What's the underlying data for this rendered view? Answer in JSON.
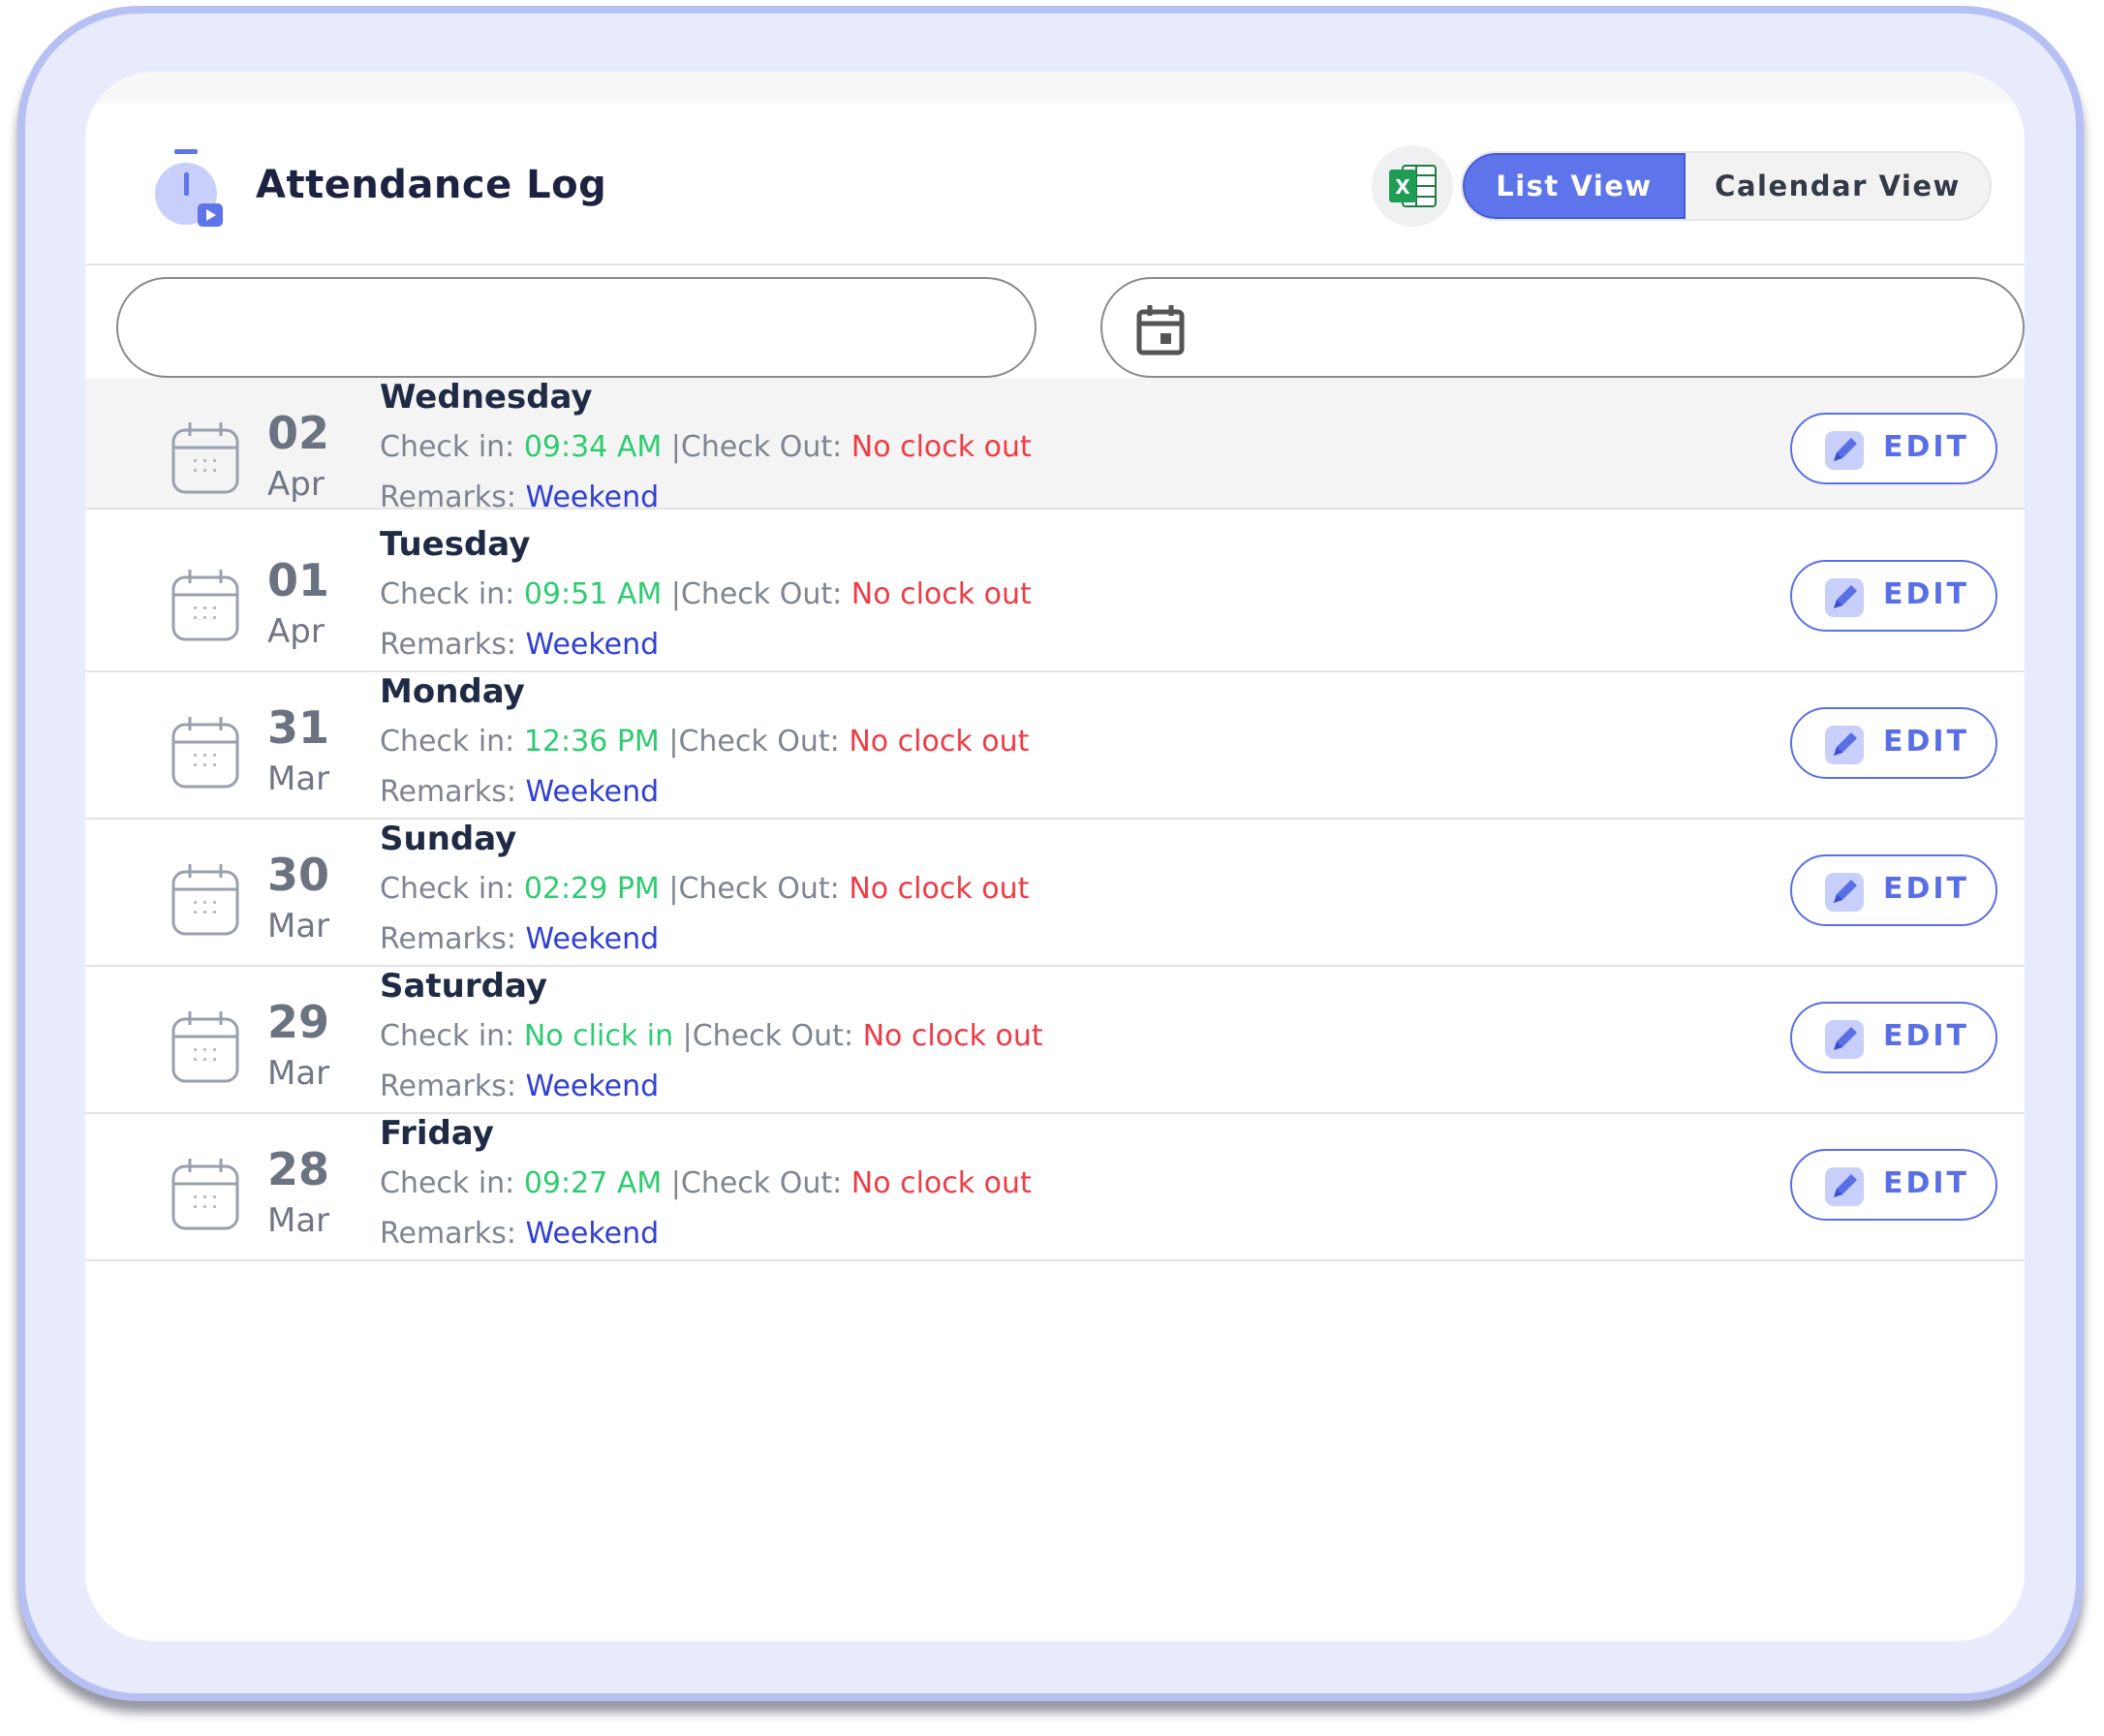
{
  "header": {
    "title": "Attendance Log",
    "excel_icon": "excel-icon",
    "views": [
      {
        "label": "List View",
        "active": true
      },
      {
        "label": "Calendar View",
        "active": false
      }
    ]
  },
  "filters": {
    "search_value": "",
    "date_value": "",
    "date_icon": "calendar-icon"
  },
  "labels": {
    "check_in": "Check in: ",
    "check_out": "Check Out: ",
    "separator": "|",
    "remarks": "Remarks: ",
    "edit": "EDIT"
  },
  "colors": {
    "accent": "#5e74ea",
    "check_in": "#2ecc71",
    "check_out": "#ef3b44",
    "remarks": "#2f3fd1"
  },
  "records": [
    {
      "day": "02",
      "month": "Apr",
      "weekday": "Wednesday",
      "check_in": "09:34 AM",
      "check_out": "No clock out",
      "remarks": "Weekend"
    },
    {
      "day": "01",
      "month": "Apr",
      "weekday": "Tuesday",
      "check_in": "09:51 AM",
      "check_out": "No clock out",
      "remarks": "Weekend"
    },
    {
      "day": "31",
      "month": "Mar",
      "weekday": "Monday",
      "check_in": "12:36 PM",
      "check_out": "No clock out",
      "remarks": "Weekend"
    },
    {
      "day": "30",
      "month": "Mar",
      "weekday": "Sunday",
      "check_in": "02:29 PM",
      "check_out": "No clock out",
      "remarks": "Weekend"
    },
    {
      "day": "29",
      "month": "Mar",
      "weekday": "Saturday",
      "check_in": "No click in",
      "check_out": "No clock out",
      "remarks": "Weekend"
    },
    {
      "day": "28",
      "month": "Mar",
      "weekday": "Friday",
      "check_in": "09:27 AM",
      "check_out": "No clock out",
      "remarks": "Weekend"
    }
  ]
}
